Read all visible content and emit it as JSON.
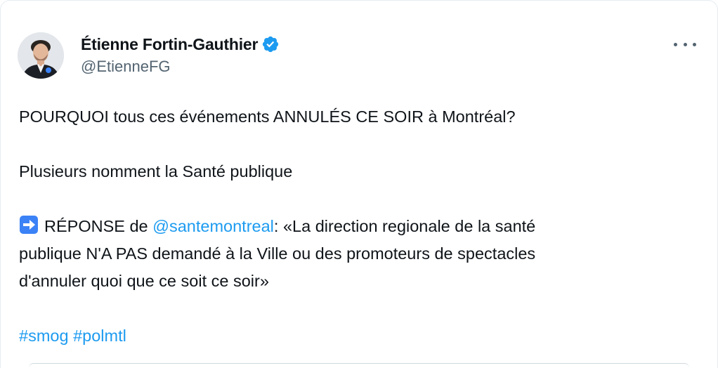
{
  "author": {
    "display_name": "Étienne Fortin-Gauthier",
    "handle": "@EtienneFG",
    "avatar_icon": "profile-photo",
    "verified_icon": "verified-badge-icon"
  },
  "menu": {
    "more_icon": "more-horizontal-icon"
  },
  "tweet": {
    "line1": "POURQUOI tous ces événements ANNULÉS CE SOIR à Montréal?",
    "line2": "Plusieurs nomment la Santé publique",
    "reply_prefix": "RÉPONSE de ",
    "mention": "@santemontreal",
    "reply_text_1": ": «La direction regionale de la santé",
    "reply_text_2": "publique N'A PAS demandé à la Ville ou des promoteurs de spectacles",
    "reply_text_3": "d'annuler quoi que ce soit ce soir»",
    "hashtags": [
      "#smog",
      "#polmtl"
    ]
  },
  "colors": {
    "link": "#1d9bf0",
    "verified": "#1d9bf0",
    "secondary_text": "#536471",
    "arrow_emoji_bg": "#3b82f6"
  }
}
